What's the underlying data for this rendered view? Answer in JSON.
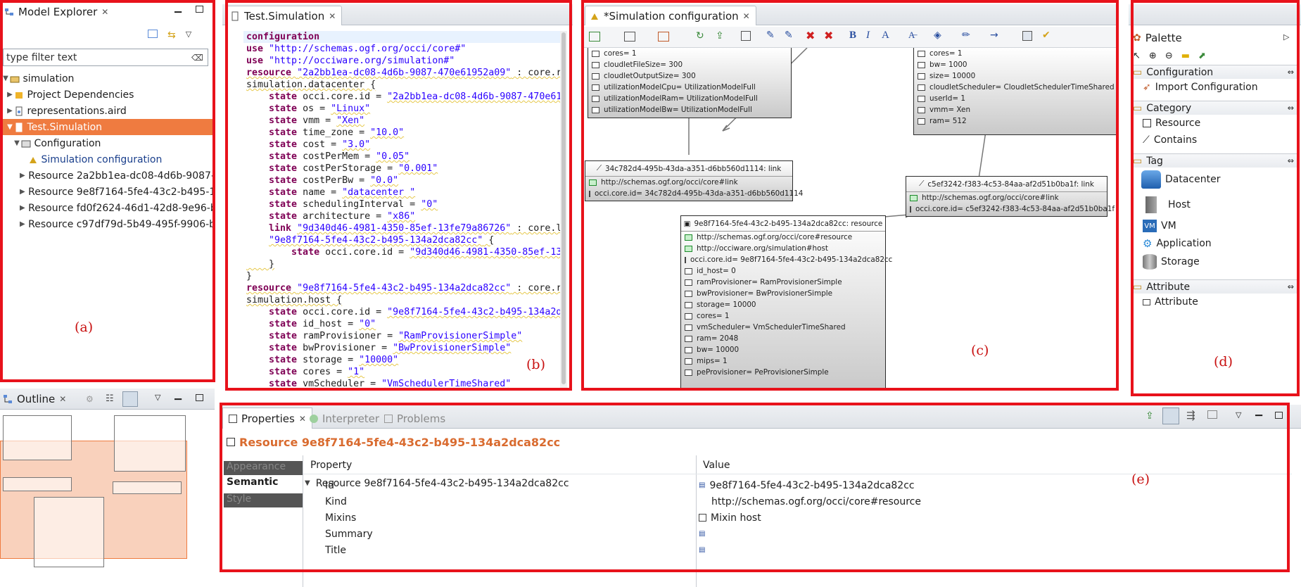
{
  "model_explorer": {
    "title": "Model Explorer",
    "filter_placeholder": "type filter text",
    "tree": [
      {
        "label": "simulation"
      },
      {
        "label": "Project Dependencies"
      },
      {
        "label": "representations.aird"
      },
      {
        "label": "Test.Simulation"
      },
      {
        "label": "Configuration"
      },
      {
        "label": "Simulation configuration"
      },
      {
        "label": "Resource 2a2bb1ea-dc08-4d6b-9087-"
      },
      {
        "label": "Resource 9e8f7164-5fe4-43c2-b495-1"
      },
      {
        "label": "Resource fd0f2624-46d1-42d8-9e96-b"
      },
      {
        "label": "Resource c97df79d-5b49-495f-9906-b"
      }
    ]
  },
  "outline": {
    "title": "Outline"
  },
  "editor": {
    "tab": "Test.Simulation",
    "lines": [
      [
        {
          "t": "configuration",
          "c": "kw"
        }
      ],
      [
        {
          "t": "use ",
          "c": "kw"
        },
        {
          "t": "\"http://schemas.ogf.org/occi/core#\"",
          "c": "str"
        }
      ],
      [
        {
          "t": "use ",
          "c": "kw"
        },
        {
          "t": "\"http://occiware.org/simulation#\"",
          "c": "str"
        }
      ],
      [
        {
          "t": "resource ",
          "c": "kw sq"
        },
        {
          "t": "\"2a2bb1ea-dc08-4d6b-9087-470e61952a09\"",
          "c": "str sq"
        },
        {
          "t": " : core.r",
          "c": "sq"
        }
      ],
      [
        {
          "t": "simulation.datacenter {",
          "c": "sq"
        }
      ],
      [
        {
          "t": "    "
        },
        {
          "t": "state ",
          "c": "kw"
        },
        {
          "t": "occi.core.id = "
        },
        {
          "t": "\"2a2bb1ea-dc08-4d6b-9087-470e61",
          "c": "str sq"
        }
      ],
      [
        {
          "t": "    "
        },
        {
          "t": "state ",
          "c": "kw"
        },
        {
          "t": "os = "
        },
        {
          "t": "\"Linux\"",
          "c": "str sq"
        }
      ],
      [
        {
          "t": "    "
        },
        {
          "t": "state ",
          "c": "kw"
        },
        {
          "t": "vmm = "
        },
        {
          "t": "\"Xen\"",
          "c": "str sq"
        }
      ],
      [
        {
          "t": "    "
        },
        {
          "t": "state ",
          "c": "kw"
        },
        {
          "t": "time_zone = "
        },
        {
          "t": "\"10.0\"",
          "c": "str sq"
        }
      ],
      [
        {
          "t": "    "
        },
        {
          "t": "state ",
          "c": "kw"
        },
        {
          "t": "cost = "
        },
        {
          "t": "\"3.0\"",
          "c": "str sq"
        }
      ],
      [
        {
          "t": "    "
        },
        {
          "t": "state ",
          "c": "kw"
        },
        {
          "t": "costPerMem = "
        },
        {
          "t": "\"0.05\"",
          "c": "str sq"
        }
      ],
      [
        {
          "t": "    "
        },
        {
          "t": "state ",
          "c": "kw"
        },
        {
          "t": "costPerStorage = "
        },
        {
          "t": "\"0.001\"",
          "c": "str sq"
        }
      ],
      [
        {
          "t": "    "
        },
        {
          "t": "state ",
          "c": "kw"
        },
        {
          "t": "costPerBw = "
        },
        {
          "t": "\"0.0\"",
          "c": "str sq"
        }
      ],
      [
        {
          "t": "    "
        },
        {
          "t": "state ",
          "c": "kw"
        },
        {
          "t": "name = "
        },
        {
          "t": "\"datacenter \"",
          "c": "str sq"
        }
      ],
      [
        {
          "t": "    "
        },
        {
          "t": "state ",
          "c": "kw"
        },
        {
          "t": "schedulingInterval = "
        },
        {
          "t": "\"0\"",
          "c": "str sq"
        }
      ],
      [
        {
          "t": "    "
        },
        {
          "t": "state ",
          "c": "kw"
        },
        {
          "t": "architecture = "
        },
        {
          "t": "\"x86\"",
          "c": "str sq"
        }
      ],
      [
        {
          "t": "    "
        },
        {
          "t": "link ",
          "c": "kw"
        },
        {
          "t": "\"9d340d46-4981-4350-85ef-13fe79a86726\"",
          "c": "str sq"
        },
        {
          "t": " : core.l",
          "c": "sq"
        }
      ],
      [
        {
          "t": "    "
        },
        {
          "t": "\"9e8f7164-5fe4-43c2-b495-134a2dca82cc\"",
          "c": "str sq"
        },
        {
          "t": " {",
          "c": "sq"
        }
      ],
      [
        {
          "t": "        "
        },
        {
          "t": "state ",
          "c": "kw"
        },
        {
          "t": "occi.core.id = "
        },
        {
          "t": "\"9d340d46-4981-4350-85ef-13",
          "c": "str sq"
        }
      ],
      [
        {
          "t": "    }",
          "c": "sq"
        }
      ],
      [
        {
          "t": "}"
        }
      ],
      [
        {
          "t": "resource ",
          "c": "kw sq"
        },
        {
          "t": "\"9e8f7164-5fe4-43c2-b495-134a2dca82cc\"",
          "c": "str sq"
        },
        {
          "t": " : core.r",
          "c": "sq"
        }
      ],
      [
        {
          "t": "simulation.host {",
          "c": "sq"
        }
      ],
      [
        {
          "t": "    "
        },
        {
          "t": "state ",
          "c": "kw"
        },
        {
          "t": "occi.core.id = "
        },
        {
          "t": "\"9e8f7164-5fe4-43c2-b495-134a2d",
          "c": "str sq"
        }
      ],
      [
        {
          "t": "    "
        },
        {
          "t": "state ",
          "c": "kw"
        },
        {
          "t": "id_host = "
        },
        {
          "t": "\"0\"",
          "c": "str sq"
        }
      ],
      [
        {
          "t": "    "
        },
        {
          "t": "state ",
          "c": "kw"
        },
        {
          "t": "ramProvisioner = "
        },
        {
          "t": "\"RamProvisionerSimple\"",
          "c": "str sq"
        }
      ],
      [
        {
          "t": "    "
        },
        {
          "t": "state ",
          "c": "kw"
        },
        {
          "t": "bwProvisioner = "
        },
        {
          "t": "\"BwProvisionerSimple\"",
          "c": "str sq"
        }
      ],
      [
        {
          "t": "    "
        },
        {
          "t": "state ",
          "c": "kw"
        },
        {
          "t": "storage = "
        },
        {
          "t": "\"10000\"",
          "c": "str sq"
        }
      ],
      [
        {
          "t": "    "
        },
        {
          "t": "state ",
          "c": "kw"
        },
        {
          "t": "cores = "
        },
        {
          "t": "\"1\"",
          "c": "str sq"
        }
      ],
      [
        {
          "t": "    "
        },
        {
          "t": "state ",
          "c": "kw"
        },
        {
          "t": "vmScheduler = "
        },
        {
          "t": "\"VmSchedulerTimeShared\"",
          "c": "str sq"
        }
      ]
    ]
  },
  "diagram": {
    "tab": "*Simulation configuration",
    "node_tl": [
      "cores= 1",
      "cloudletFileSize= 300",
      "cloudletOutputSize= 300",
      "utilizationModelCpu= UtilizationModelFull",
      "utilizationModelRam= UtilizationModelFull",
      "utilizationModelBw= UtilizationModelFull"
    ],
    "node_tr": [
      "cores= 1",
      "bw= 1000",
      "size= 10000",
      "cloudletScheduler= CloudletSchedulerTimeShared",
      "userId= 1",
      "vmm= Xen",
      "ram= 512"
    ],
    "link1": {
      "title": "34c782d4-495b-43da-a351-d6bb560d1114: link",
      "rows": [
        "http://schemas.ogf.org/occi/core#link",
        "occi.core.id= 34c782d4-495b-43da-a351-d6bb560d1114"
      ]
    },
    "link2": {
      "title": "c5ef3242-f383-4c53-84aa-af2d51b0ba1f: link",
      "rows": [
        "http://schemas.ogf.org/occi/core#link",
        "occi.core.id= c5ef3242-f383-4c53-84aa-af2d51b0ba1f"
      ]
    },
    "resource": {
      "title": "9e8f7164-5fe4-43c2-b495-134a2dca82cc: resource",
      "rows": [
        "http://schemas.ogf.org/occi/core#resource",
        "http://occiware.org/simulation#host",
        "occi.core.id= 9e8f7164-5fe4-43c2-b495-134a2dca82cc",
        "id_host= 0",
        "ramProvisioner= RamProvisionerSimple",
        "bwProvisioner= BwProvisionerSimple",
        "storage= 10000",
        "cores= 1",
        "vmScheduler= VmSchedulerTimeShared",
        "ram= 2048",
        "bw= 10000",
        "mips= 1",
        "peProvisioner= PeProvisionerSimple"
      ]
    }
  },
  "palette": {
    "title": "Palette",
    "cat_configuration": "Configuration",
    "import_configuration": "Import Configuration",
    "cat_category": "Category",
    "resource": "Resource",
    "contains": "Contains",
    "cat_tag": "Tag",
    "datacenter": "Datacenter",
    "host": "Host",
    "vm": "VM",
    "application": "Application",
    "storage": "Storage",
    "cat_attribute": "Attribute",
    "attribute": "Attribute"
  },
  "properties": {
    "tabs": [
      "Properties",
      "Interpreter",
      "Problems"
    ],
    "title": "Resource 9e8f7164-5fe4-43c2-b495-134a2dca82cc",
    "side_tabs": [
      "Appearance",
      "Semantic",
      "Style"
    ],
    "col_property": "Property",
    "col_value": "Value",
    "group": "Resource 9e8f7164-5fe4-43c2-b495-134a2dca82cc",
    "rows": [
      {
        "name": "Id",
        "value": "9e8f7164-5fe4-43c2-b495-134a2dca82cc"
      },
      {
        "name": "Kind",
        "value": "http://schemas.ogf.org/occi/core#resource"
      },
      {
        "name": "Mixins",
        "value": "Mixin host"
      },
      {
        "name": "Summary",
        "value": ""
      },
      {
        "name": "Title",
        "value": ""
      }
    ]
  },
  "labels": {
    "a": "(a)",
    "b": "(b)",
    "c": "(c)",
    "d": "(d)",
    "e": "(e)"
  },
  "colors": {
    "accent": "#ef7b40",
    "annotation": "#e8121b",
    "keyword": "#7f0055",
    "string": "#2a00ff"
  }
}
